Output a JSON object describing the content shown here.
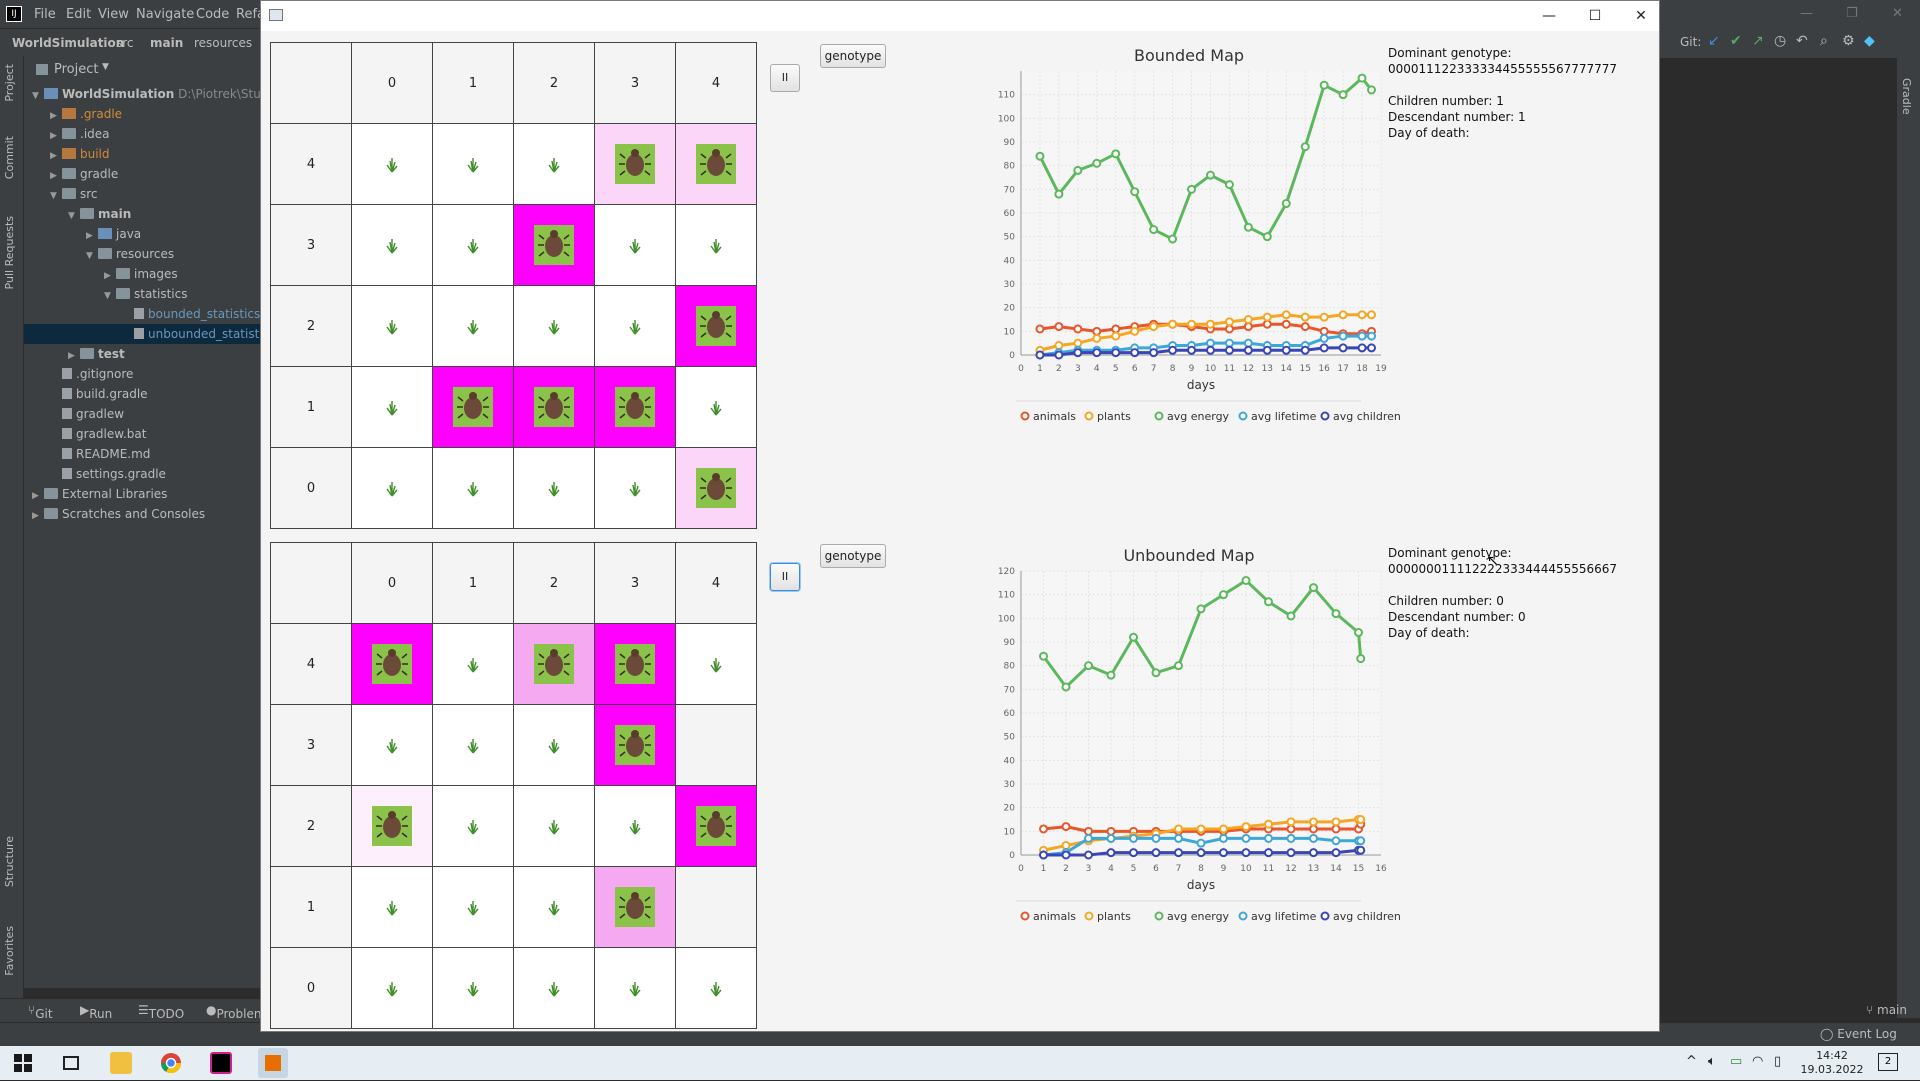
{
  "ide": {
    "menu": [
      "File",
      "Edit",
      "View",
      "Navigate",
      "Code",
      "Refa"
    ],
    "breadcrumbs": [
      "WorldSimulation",
      "src",
      "main",
      "resources"
    ],
    "project_title": "Project",
    "project_tree": [
      {
        "label": "WorldSimulation",
        "extra": "D:\\Piotrek\\Studia\\",
        "depth": 0,
        "icon": "folder-blue",
        "arrow": "▼",
        "bold": true
      },
      {
        "label": ".gradle",
        "depth": 1,
        "icon": "folder-orange",
        "arrow": "▶",
        "color": "#d18a3b"
      },
      {
        "label": ".idea",
        "depth": 1,
        "icon": "folder",
        "arrow": "▶"
      },
      {
        "label": "build",
        "depth": 1,
        "icon": "folder-orange",
        "arrow": "▶",
        "color": "#d18a3b"
      },
      {
        "label": "gradle",
        "depth": 1,
        "icon": "folder",
        "arrow": "▶"
      },
      {
        "label": "src",
        "depth": 1,
        "icon": "folder",
        "arrow": "▼"
      },
      {
        "label": "main",
        "depth": 2,
        "icon": "folder",
        "arrow": "▼",
        "bold": true
      },
      {
        "label": "java",
        "depth": 3,
        "icon": "folder-blue",
        "arrow": "▶"
      },
      {
        "label": "resources",
        "depth": 3,
        "icon": "folder",
        "arrow": "▼"
      },
      {
        "label": "images",
        "depth": 4,
        "icon": "folder",
        "arrow": "▶"
      },
      {
        "label": "statistics",
        "depth": 4,
        "icon": "folder",
        "arrow": "▼"
      },
      {
        "label": "bounded_statistics.c",
        "depth": 5,
        "icon": "file",
        "arrow": "",
        "color": "#6897bb"
      },
      {
        "label": "unbounded_statistic",
        "depth": 5,
        "icon": "file",
        "arrow": "",
        "color": "#6897bb",
        "selected": true
      },
      {
        "label": "test",
        "depth": 2,
        "icon": "folder",
        "arrow": "▶",
        "bold": true
      },
      {
        "label": ".gitignore",
        "depth": 1,
        "icon": "file",
        "arrow": ""
      },
      {
        "label": "build.gradle",
        "depth": 1,
        "icon": "file",
        "arrow": ""
      },
      {
        "label": "gradlew",
        "depth": 1,
        "icon": "file",
        "arrow": ""
      },
      {
        "label": "gradlew.bat",
        "depth": 1,
        "icon": "file",
        "arrow": ""
      },
      {
        "label": "README.md",
        "depth": 1,
        "icon": "file",
        "arrow": ""
      },
      {
        "label": "settings.gradle",
        "depth": 1,
        "icon": "file",
        "arrow": ""
      },
      {
        "label": "External Libraries",
        "depth": 0,
        "icon": "folder",
        "arrow": "▶"
      },
      {
        "label": "Scratches and Consoles",
        "depth": 0,
        "icon": "folder",
        "arrow": "▶"
      }
    ],
    "left_tabs": [
      "Project",
      "Commit",
      "Pull Requests",
      "Structure",
      "Favorites"
    ],
    "right_tabs": [
      "Gradle"
    ],
    "bottom_tabs": [
      "Git",
      "Run",
      "TODO",
      "Problen"
    ],
    "git_label": "Git:",
    "event_log": "Event Log",
    "branch": "main"
  },
  "taskbar": {
    "time": "14:42",
    "date": "19.03.2022",
    "notifications": "2"
  },
  "bounded": {
    "col_headers": [
      "0",
      "1",
      "2",
      "3",
      "4"
    ],
    "row_headers": [
      "4",
      "3",
      "2",
      "1",
      "0"
    ],
    "cells": [
      [
        "g",
        "g",
        "g",
        "a:light",
        "a:light"
      ],
      [
        "g",
        "g",
        "a:dark",
        "g",
        "g"
      ],
      [
        "g",
        "g",
        "g",
        "g",
        "a:dark"
      ],
      [
        "g",
        "a:dark",
        "a:dark",
        "a:dark",
        "g"
      ],
      [
        "g",
        "g",
        "g",
        "g",
        "a:light"
      ]
    ],
    "pause_label": "II",
    "genotype_label": "genotype",
    "info": {
      "dominant_label": "Dominant genotype:",
      "dominant_value": "000011122333334455555567777777",
      "children": "Children number: 1",
      "descendants": "Descendant number: 1",
      "death": "Day of death:"
    }
  },
  "unbounded": {
    "col_headers": [
      "0",
      "1",
      "2",
      "3",
      "4"
    ],
    "row_headers": [
      "4",
      "3",
      "2",
      "1",
      "0"
    ],
    "cells": [
      [
        "a:dark",
        "g",
        "a:mid",
        "a:dark",
        "g"
      ],
      [
        "g",
        "g",
        "g",
        "a:dark",
        "e"
      ],
      [
        "a:pale",
        "g",
        "g",
        "g",
        "a:dark"
      ],
      [
        "g",
        "g",
        "g",
        "a:mid",
        "e"
      ],
      [
        "g",
        "g",
        "g",
        "g",
        "g"
      ]
    ],
    "pause_label": "II",
    "genotype_label": "genotype",
    "info": {
      "dominant_label": "Dominant genotype:",
      "dominant_value": "000000011112222333444455556667",
      "children": "Children number: 0",
      "descendants": "Descendant number: 0",
      "death": "Day of death:"
    }
  },
  "chart_data": [
    {
      "type": "line",
      "title": "Bounded Map",
      "xlabel": "days",
      "ylabel": "",
      "xlim": [
        0,
        19
      ],
      "ylim": [
        0,
        120
      ],
      "x_ticks": [
        0,
        1,
        2,
        3,
        4,
        5,
        6,
        7,
        8,
        9,
        10,
        11,
        12,
        13,
        14,
        15,
        16,
        17,
        18,
        19
      ],
      "y_ticks": [
        0,
        10,
        20,
        30,
        40,
        50,
        60,
        70,
        80,
        90,
        100,
        110
      ],
      "grid": true,
      "legend_position": "bottom",
      "series": [
        {
          "name": "animals",
          "color": "#e8562a",
          "x": [
            1,
            2,
            3,
            4,
            5,
            6,
            7,
            8,
            9,
            10,
            11,
            12,
            13,
            14,
            15,
            16,
            17,
            18,
            18.5
          ],
          "values": [
            11,
            12,
            11,
            10,
            11,
            12,
            13,
            13,
            12,
            11,
            11,
            12,
            13,
            13,
            12,
            10,
            9,
            9,
            10
          ]
        },
        {
          "name": "plants",
          "color": "#f5a623",
          "x": [
            1,
            2,
            3,
            4,
            5,
            6,
            7,
            8,
            9,
            10,
            11,
            12,
            13,
            14,
            15,
            16,
            17,
            18,
            18.5
          ],
          "values": [
            2,
            4,
            5,
            7,
            8,
            10,
            12,
            13,
            13,
            13,
            14,
            15,
            16,
            17,
            16,
            16,
            17,
            17,
            17
          ]
        },
        {
          "name": "avg energy",
          "color": "#5cb85c",
          "x": [
            1,
            2,
            3,
            4,
            5,
            6,
            7,
            8,
            9,
            10,
            11,
            12,
            13,
            14,
            15,
            16,
            17,
            18,
            18.5
          ],
          "values": [
            84,
            68,
            78,
            81,
            85,
            69,
            53,
            49,
            70,
            76,
            72,
            54,
            50,
            64,
            88,
            114,
            110,
            117,
            112
          ]
        },
        {
          "name": "avg lifetime",
          "color": "#3ea6d8",
          "x": [
            1,
            2,
            3,
            4,
            5,
            6,
            7,
            8,
            9,
            10,
            11,
            12,
            13,
            14,
            15,
            16,
            17,
            18,
            18.5
          ],
          "values": [
            0,
            1,
            2,
            2,
            2,
            3,
            3,
            4,
            4,
            5,
            5,
            5,
            4,
            4,
            4,
            7,
            8,
            8,
            8
          ]
        },
        {
          "name": "avg children",
          "color": "#3b46b5",
          "x": [
            1,
            2,
            3,
            4,
            5,
            6,
            7,
            8,
            9,
            10,
            11,
            12,
            13,
            14,
            15,
            16,
            17,
            18,
            18.5
          ],
          "values": [
            0,
            0,
            1,
            1,
            1,
            1,
            1,
            2,
            2,
            2,
            2,
            2,
            2,
            2,
            2,
            3,
            3,
            3,
            3
          ]
        }
      ]
    },
    {
      "type": "line",
      "title": "Unbounded Map",
      "xlabel": "days",
      "ylabel": "",
      "xlim": [
        0,
        16
      ],
      "ylim": [
        0,
        120
      ],
      "x_ticks": [
        0,
        1,
        2,
        3,
        4,
        5,
        6,
        7,
        8,
        9,
        10,
        11,
        12,
        13,
        14,
        15,
        16
      ],
      "y_ticks": [
        0,
        10,
        20,
        30,
        40,
        50,
        60,
        70,
        80,
        90,
        100,
        110,
        120
      ],
      "grid": true,
      "legend_position": "bottom",
      "series": [
        {
          "name": "animals",
          "color": "#e8562a",
          "x": [
            1,
            2,
            3,
            4,
            5,
            6,
            7,
            8,
            9,
            10,
            11,
            12,
            13,
            14,
            15,
            15.1
          ],
          "values": [
            11,
            12,
            10,
            10,
            10,
            10,
            10,
            10,
            10,
            11,
            11,
            11,
            11,
            11,
            11,
            13
          ]
        },
        {
          "name": "plants",
          "color": "#f5a623",
          "x": [
            1,
            2,
            3,
            4,
            5,
            6,
            7,
            8,
            9,
            10,
            11,
            12,
            13,
            14,
            15,
            15.1
          ],
          "values": [
            2,
            4,
            6,
            7,
            8,
            9,
            11,
            11,
            11,
            12,
            13,
            14,
            14,
            14,
            15,
            15
          ]
        },
        {
          "name": "avg energy",
          "color": "#5cb85c",
          "x": [
            1,
            2,
            3,
            4,
            5,
            6,
            7,
            8,
            9,
            10,
            11,
            12,
            13,
            14,
            15,
            15.1
          ],
          "values": [
            84,
            71,
            80,
            76,
            92,
            77,
            80,
            104,
            110,
            116,
            107,
            101,
            113,
            102,
            94,
            83
          ]
        },
        {
          "name": "avg lifetime",
          "color": "#3ea6d8",
          "x": [
            1,
            2,
            3,
            4,
            5,
            6,
            7,
            8,
            9,
            10,
            11,
            12,
            13,
            14,
            15,
            15.1
          ],
          "values": [
            0,
            1,
            7,
            7,
            7,
            7,
            7,
            5,
            7,
            7,
            7,
            7,
            7,
            6,
            6,
            6
          ]
        },
        {
          "name": "avg children",
          "color": "#3b46b5",
          "x": [
            1,
            2,
            3,
            4,
            5,
            6,
            7,
            8,
            9,
            10,
            11,
            12,
            13,
            14,
            15,
            15.1
          ],
          "values": [
            0,
            0,
            0,
            1,
            1,
            1,
            1,
            1,
            1,
            1,
            1,
            1,
            1,
            1,
            2,
            2
          ]
        }
      ]
    }
  ]
}
